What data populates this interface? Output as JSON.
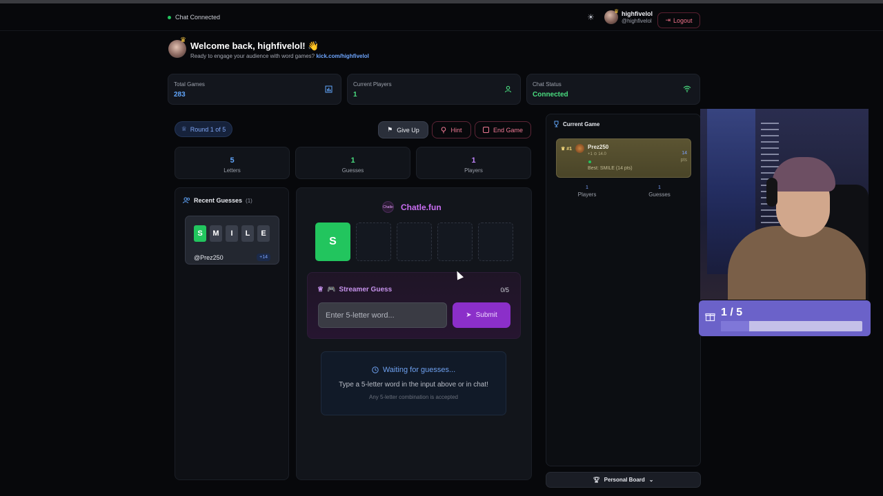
{
  "topbar": {
    "chat_status": "Chat Connected",
    "user_name": "highfivelol",
    "user_handle": "@highfivelol",
    "logout_label": "Logout"
  },
  "welcome": {
    "title": "Welcome back, highfivelol! 👋",
    "subtitle": "Ready to engage your audience with word games?",
    "link": "kick.com/highfivelol"
  },
  "stats": [
    {
      "label": "Total Games",
      "value": "283",
      "color": "#60a5fa",
      "icon": "bar-chart-icon"
    },
    {
      "label": "Current Players",
      "value": "1",
      "color": "#4ade80",
      "icon": "user-icon"
    },
    {
      "label": "Chat Status",
      "value": "Connected",
      "color": "#4ade80",
      "icon": "wifi-icon"
    }
  ],
  "controls": {
    "round": "Round 1 of 5",
    "give_up": "Give Up",
    "hint": "Hint",
    "end_game": "End Game"
  },
  "game_stats": [
    {
      "value": "5",
      "label": "Letters",
      "color": "#60a5fa"
    },
    {
      "value": "1",
      "label": "Guesses",
      "color": "#4ade80"
    },
    {
      "value": "1",
      "label": "Players",
      "color": "#c084fc"
    }
  ],
  "recent": {
    "title": "Recent Guesses",
    "count": "(1)",
    "guesses": [
      {
        "letters": [
          "S",
          "M",
          "I",
          "L",
          "E"
        ],
        "user": "@Prez250",
        "points": "+14"
      }
    ]
  },
  "board": {
    "brand": "Chatle.fun",
    "logo_text": "Chatle",
    "tiles": [
      "S",
      "",
      "",
      "",
      ""
    ]
  },
  "streamer": {
    "title": "Streamer Guess",
    "count": "0/5",
    "placeholder": "Enter 5-letter word...",
    "submit": "Submit"
  },
  "waiting": {
    "title": "Waiting for guesses...",
    "subtitle": "Type a 5-letter word in the input above or in chat!",
    "hint": "Any 5-letter combination is accepted"
  },
  "current_game": {
    "title": "Current Game",
    "player": {
      "rank": "#1",
      "name": "Prez250",
      "meta": "+1 ⊙ 14.0",
      "best": "Best: SMILE (14 pts)",
      "points": "14",
      "points_unit": "pts"
    },
    "players_value": "1",
    "players_label": "Players",
    "guesses_value": "1",
    "guesses_label": "Guesses",
    "personal_board": "Personal Board"
  },
  "overlay": {
    "gift_count": "1 / 5",
    "progress": 0.2
  }
}
